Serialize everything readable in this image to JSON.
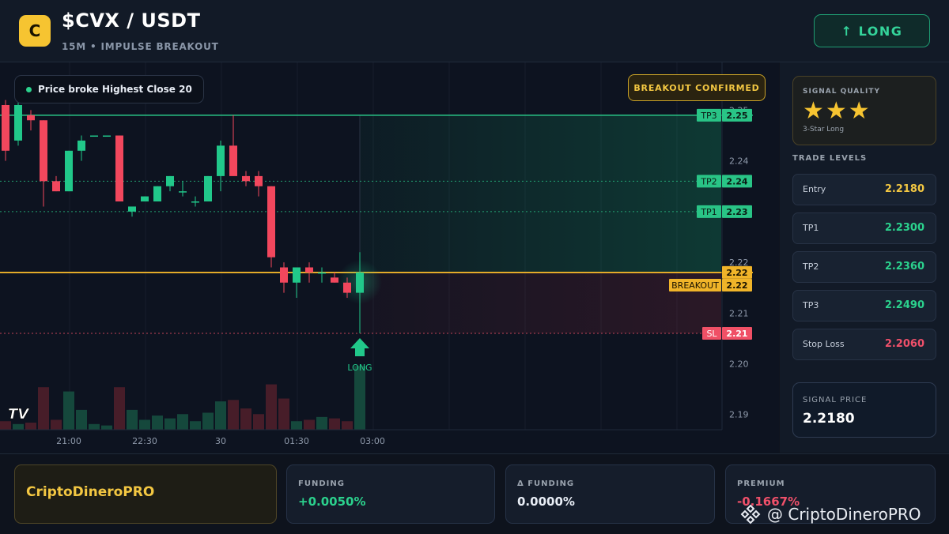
{
  "header": {
    "logo_letter": "C",
    "pair": "$CVX / USDT",
    "subtitle": "15M • IMPULSE BREAKOUT",
    "direction_button": "↑ LONG"
  },
  "chart": {
    "pill_text": "Price broke Highest Close 20",
    "confirm_badge": "BREAKOUT CONFIRMED",
    "long_label": "LONG",
    "tv_logo": "TV",
    "colors": {
      "up": "#21c88a",
      "down": "#f2475d",
      "tp": "#29c486",
      "breakout": "#f0b429",
      "sl": "#f05066"
    }
  },
  "chart_data": {
    "type": "candlestick",
    "x_ticks": [
      "21:00",
      "22:30",
      "30",
      "01:30",
      "03:00"
    ],
    "y_ticks": [
      2.25,
      2.24,
      2.22,
      2.21,
      2.2,
      2.19
    ],
    "y_tick_labels": [
      "2.25",
      "2.24",
      "2.22",
      "2.21",
      "2.20",
      "2.19"
    ],
    "ylim": [
      2.187,
      2.251
    ],
    "levels": [
      {
        "name": "TP3",
        "tag": "TP3",
        "value": 2.249,
        "label": "2.25"
      },
      {
        "name": "TP2",
        "tag": "TP2",
        "value": 2.236,
        "label": "2.24"
      },
      {
        "name": "TP1",
        "tag": "TP1",
        "value": 2.23,
        "label": "2.23"
      },
      {
        "name": "Entry",
        "tag": "",
        "value": 2.218,
        "label": "2.22"
      },
      {
        "name": "Breakout",
        "tag": "BREAKOUT",
        "value": 2.2155,
        "label": "2.22"
      },
      {
        "name": "SL",
        "tag": "SL",
        "value": 2.206,
        "label": "2.21"
      }
    ],
    "candles": [
      {
        "o": 2.251,
        "h": 2.252,
        "c": 2.242,
        "l": 2.24
      },
      {
        "o": 2.244,
        "h": 2.252,
        "c": 2.251,
        "l": 2.243
      },
      {
        "o": 2.249,
        "h": 2.25,
        "c": 2.248,
        "l": 2.246
      },
      {
        "o": 2.248,
        "h": 2.248,
        "c": 2.236,
        "l": 2.231
      },
      {
        "o": 2.236,
        "h": 2.237,
        "c": 2.234,
        "l": 2.234
      },
      {
        "o": 2.234,
        "h": 2.242,
        "c": 2.242,
        "l": 2.234
      },
      {
        "o": 2.242,
        "h": 2.245,
        "c": 2.244,
        "l": 2.24
      },
      {
        "o": 2.245,
        "h": 2.245,
        "c": 2.245,
        "l": 2.245
      },
      {
        "o": 2.245,
        "h": 2.245,
        "c": 2.245,
        "l": 2.245
      },
      {
        "o": 2.245,
        "h": 2.245,
        "c": 2.232,
        "l": 2.232
      },
      {
        "o": 2.23,
        "h": 2.231,
        "c": 2.231,
        "l": 2.229
      },
      {
        "o": 2.232,
        "h": 2.233,
        "c": 2.233,
        "l": 2.232
      },
      {
        "o": 2.232,
        "h": 2.235,
        "c": 2.235,
        "l": 2.232
      },
      {
        "o": 2.235,
        "h": 2.237,
        "c": 2.237,
        "l": 2.234
      },
      {
        "o": 2.234,
        "h": 2.236,
        "c": 2.234,
        "l": 2.233
      },
      {
        "o": 2.232,
        "h": 2.233,
        "c": 2.232,
        "l": 2.231
      },
      {
        "o": 2.232,
        "h": 2.237,
        "c": 2.237,
        "l": 2.232
      },
      {
        "o": 2.237,
        "h": 2.244,
        "c": 2.243,
        "l": 2.234
      },
      {
        "o": 2.243,
        "h": 2.249,
        "c": 2.237,
        "l": 2.237
      },
      {
        "o": 2.237,
        "h": 2.238,
        "c": 2.236,
        "l": 2.235
      },
      {
        "o": 2.237,
        "h": 2.238,
        "c": 2.235,
        "l": 2.233
      },
      {
        "o": 2.235,
        "h": 2.235,
        "c": 2.221,
        "l": 2.219
      },
      {
        "o": 2.219,
        "h": 2.22,
        "c": 2.216,
        "l": 2.214
      },
      {
        "o": 2.216,
        "h": 2.219,
        "c": 2.219,
        "l": 2.213
      },
      {
        "o": 2.219,
        "h": 2.22,
        "c": 2.218,
        "l": 2.216
      },
      {
        "o": 2.218,
        "h": 2.219,
        "c": 2.218,
        "l": 2.216
      },
      {
        "o": 2.217,
        "h": 2.218,
        "c": 2.216,
        "l": 2.216
      },
      {
        "o": 2.216,
        "h": 2.217,
        "c": 2.214,
        "l": 2.213
      },
      {
        "o": 2.214,
        "h": 2.222,
        "c": 2.218,
        "l": 2.206
      }
    ],
    "volumes": [
      0.06,
      0.04,
      0.05,
      0.3,
      0.07,
      0.27,
      0.14,
      0.04,
      0.03,
      0.3,
      0.14,
      0.07,
      0.1,
      0.08,
      0.11,
      0.06,
      0.12,
      0.2,
      0.21,
      0.15,
      0.11,
      0.32,
      0.22,
      0.06,
      0.07,
      0.09,
      0.08,
      0.06,
      0.45
    ]
  },
  "sidebar": {
    "signal_quality_title": "SIGNAL QUALITY",
    "stars": "★★★",
    "quality_label": "3-Star Long",
    "trade_levels_title": "TRADE LEVELS",
    "levels": [
      {
        "label": "Entry",
        "value": "2.2180",
        "color": "#f3c742"
      },
      {
        "label": "TP1",
        "value": "2.2300",
        "color": "#2bd18d"
      },
      {
        "label": "TP2",
        "value": "2.2360",
        "color": "#2bd18d"
      },
      {
        "label": "TP3",
        "value": "2.2490",
        "color": "#2bd18d"
      },
      {
        "label": "Stop Loss",
        "value": "2.2060",
        "color": "#f0506a"
      }
    ],
    "signal_price_title": "SIGNAL PRICE",
    "signal_price": "2.2180"
  },
  "footer": {
    "brand": "CriptoDineroPRO",
    "cards": [
      {
        "title": "FUNDING",
        "value": "+0.0050%",
        "color": "#2bd18d"
      },
      {
        "title": "Δ FUNDING",
        "value": "0.0000%",
        "color": "#e9eef6"
      },
      {
        "title": "PREMIUM",
        "value": "-0.1667%",
        "color": "#f0506a"
      }
    ],
    "watermark": "@ CriptoDineroPRO"
  }
}
